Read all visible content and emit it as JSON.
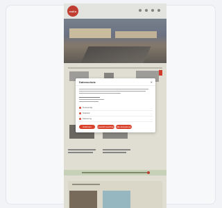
{
  "site": {
    "logo_text": "radio",
    "nav_icons": [
      "search-icon",
      "user-icon",
      "menu-icon",
      "more-icon"
    ],
    "accent_color": "#cf3a2c",
    "green_bar_color": "#d7e2c7"
  },
  "modal": {
    "title": "Datenschutz",
    "close_label": "",
    "close_symbol": "✕",
    "options": [
      {
        "label": "Notwendig",
        "toggle": "›"
      },
      {
        "label": "Statistik",
        "toggle": "›"
      },
      {
        "label": "Marketing",
        "toggle": "›"
      }
    ],
    "buttons": [
      {
        "label": "Ablehnen"
      },
      {
        "label": "Auswahl speichern"
      },
      {
        "label": "Alle akzeptieren"
      }
    ]
  }
}
